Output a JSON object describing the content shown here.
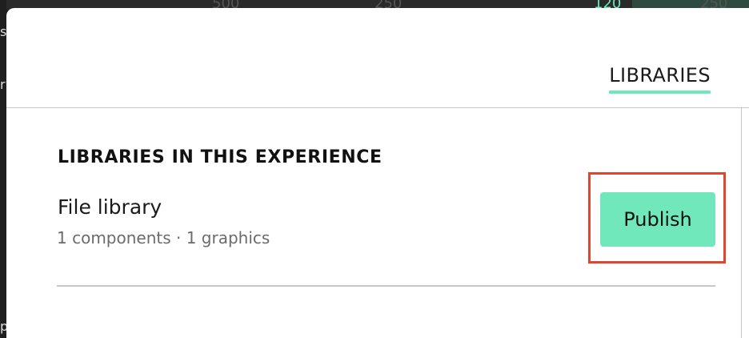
{
  "background": {
    "numbers": [
      "500",
      "250",
      "120",
      "250"
    ],
    "left_marks": [
      "s",
      "r",
      "p"
    ]
  },
  "tabs": [
    {
      "label": "LIBRARIES",
      "active": true
    }
  ],
  "section": {
    "heading": "LIBRARIES IN THIS EXPERIENCE"
  },
  "library": {
    "name": "File library",
    "meta": "1 components · 1 graphics",
    "publish_label": "Publish"
  },
  "colors": {
    "accent": "#70e8bb",
    "highlight_border": "#e0452f",
    "text_muted": "#6b6b6b",
    "divider": "#c7c7c7"
  }
}
